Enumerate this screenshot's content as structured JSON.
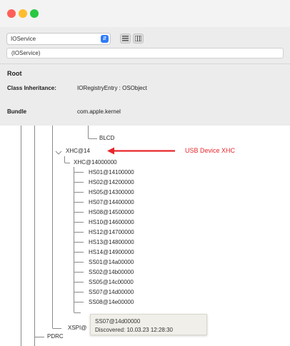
{
  "window": {
    "traffic_lights": {
      "close_color": "#ff5f57",
      "minimize_color": "#febc2e",
      "zoom_color": "#28c840"
    }
  },
  "toolbar": {
    "plane_select_value": "IOService",
    "search_value": "(IOService)",
    "accent_color": "#2f7cf6"
  },
  "info": {
    "title": "Root",
    "inheritance_label": "Class Inheritance:",
    "inheritance_value": "IORegistryEntry : OSObject",
    "bundle_label": "Bundle",
    "bundle_value": "com.apple.kernel"
  },
  "tree": {
    "top_partial": "BLCD",
    "xhc": "XHC@14",
    "xhc_child": "XHC@14000000",
    "ports": [
      "HS01@14100000",
      "HS02@14200000",
      "HS05@14300000",
      "HS07@14400000",
      "HS08@14500000",
      "HS10@14600000",
      "HS12@14700000",
      "HS13@14800000",
      "HS14@14900000",
      "SS01@14a00000",
      "SS02@14b00000",
      "SS05@14c00000",
      "SS07@14d00000",
      "SS08@14e00000"
    ],
    "xspi": "XSPI@",
    "pdrc": "PDRC"
  },
  "annotation": {
    "text": "USB Device XHC",
    "color": "#e8262b"
  },
  "tooltip": {
    "name": "SS07@14d00000",
    "discovered": "Discovered: 10.03.23 12:28:30"
  }
}
